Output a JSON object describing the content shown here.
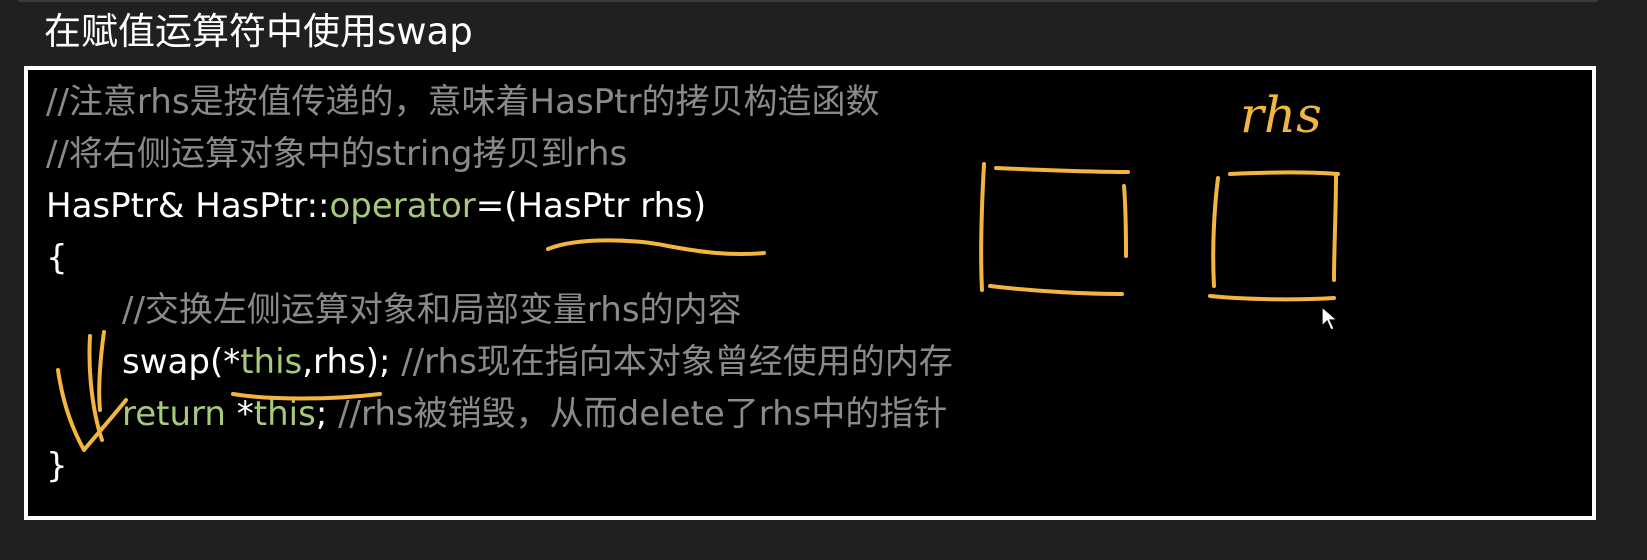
{
  "slide": {
    "title": "在赋值运算符中使用swap"
  },
  "code": {
    "line1_comment": "//注意rhs是按值传递的，意味着HasPtr的拷贝构造函数",
    "line2_comment": "//将右侧运算对象中的string拷贝到rhs",
    "line3_type": "HasPtr& HasPtr::",
    "line3_op": "operator",
    "line3_rest": "=(HasPtr rhs)",
    "line4_brace": "{",
    "line5_comment": "//交换左侧运算对象和局部变量rhs的内容",
    "line6_call_a": "swap(*",
    "line6_this": "this",
    "line6_call_b": ",rhs); ",
    "line6_comment": "//rhs现在指向本对象曾经使用的内存",
    "line7_return": "return",
    "line7_mid": " *",
    "line7_this": "this",
    "line7_semi": "; ",
    "line7_comment": "//rhs被销毁，从而delete了rhs中的指针",
    "line8_brace": "}"
  },
  "annotation": {
    "handwritten_label": "rhs",
    "ink_color": "#f2b640"
  },
  "colors": {
    "background": "#202020",
    "code_background": "#000000",
    "code_border": "#ffffff",
    "comment": "#8a8a8a",
    "keyword": "#a6c97b",
    "text": "#ffffff"
  }
}
